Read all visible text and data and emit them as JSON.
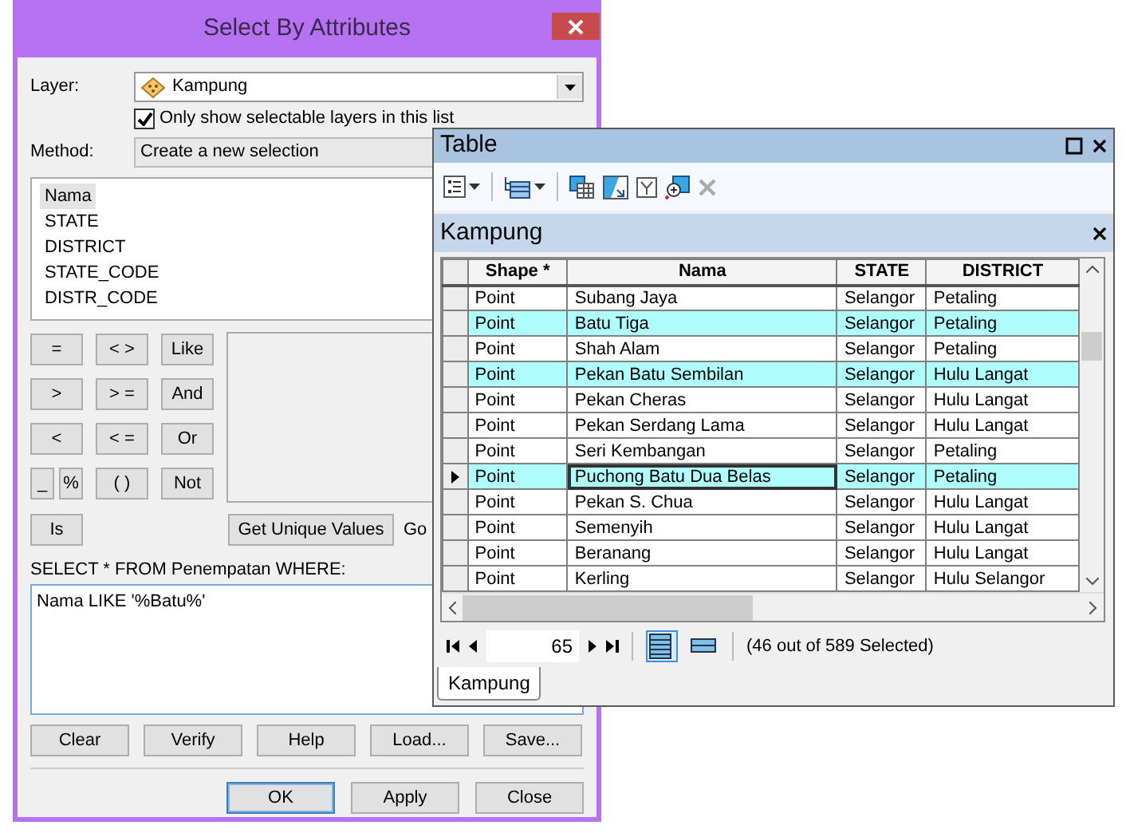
{
  "dialog": {
    "title": "Select By Attributes",
    "layer": {
      "label": "Layer:",
      "value": "Kampung"
    },
    "only_selectable": {
      "label": "Only show selectable layers in this list",
      "checked": true
    },
    "method": {
      "label": "Method:",
      "value": "Create a new selection"
    },
    "fields": [
      {
        "label": "Nama",
        "selected": true
      },
      {
        "label": "STATE",
        "selected": false
      },
      {
        "label": "DISTRICT",
        "selected": false
      },
      {
        "label": "STATE_CODE",
        "selected": false
      },
      {
        "label": "DISTR_CODE",
        "selected": false
      }
    ],
    "operator_rows": [
      [
        [
          "="
        ],
        [
          "< >"
        ],
        [
          "Like"
        ]
      ],
      [
        [
          ">"
        ],
        [
          "> ="
        ],
        [
          "And"
        ]
      ],
      [
        [
          "<"
        ],
        [
          "< ="
        ],
        [
          "Or"
        ]
      ],
      [
        [
          "_",
          "%"
        ],
        [
          "( )"
        ],
        [
          "Not"
        ]
      ]
    ],
    "is_button": "Is",
    "unique_values_button": "Get Unique Values",
    "go_to_button": "Go",
    "query_label": "SELECT * FROM Penempatan WHERE:",
    "query": "Nama LIKE '%Batu%'",
    "buttons": [
      "Clear",
      "Verify",
      "Help",
      "Load...",
      "Save..."
    ],
    "footer_buttons": [
      {
        "label": "OK",
        "default": true
      },
      {
        "label": "Apply",
        "default": false
      },
      {
        "label": "Close",
        "default": false
      }
    ]
  },
  "table_window": {
    "title": "Table",
    "layer_title": "Kampung",
    "columns": [
      "Shape *",
      "Nama",
      "STATE",
      "DISTRICT"
    ],
    "rows": [
      {
        "cells": [
          "Point",
          "Subang Jaya",
          "Selangor",
          "Petaling"
        ],
        "selected": false,
        "current": false
      },
      {
        "cells": [
          "Point",
          "Batu Tiga",
          "Selangor",
          "Petaling"
        ],
        "selected": true,
        "current": false
      },
      {
        "cells": [
          "Point",
          "Shah Alam",
          "Selangor",
          "Petaling"
        ],
        "selected": false,
        "current": false
      },
      {
        "cells": [
          "Point",
          "Pekan Batu Sembilan",
          "Selangor",
          "Hulu Langat"
        ],
        "selected": true,
        "current": false
      },
      {
        "cells": [
          "Point",
          "Pekan Cheras",
          "Selangor",
          "Hulu Langat"
        ],
        "selected": false,
        "current": false
      },
      {
        "cells": [
          "Point",
          "Pekan Serdang Lama",
          "Selangor",
          "Hulu Langat"
        ],
        "selected": false,
        "current": false
      },
      {
        "cells": [
          "Point",
          "Seri Kembangan",
          "Selangor",
          "Petaling"
        ],
        "selected": false,
        "current": false
      },
      {
        "cells": [
          "Point",
          "Puchong Batu Dua Belas",
          "Selangor",
          "Petaling"
        ],
        "selected": true,
        "current": true
      },
      {
        "cells": [
          "Point",
          "Pekan S. Chua",
          "Selangor",
          "Hulu Langat"
        ],
        "selected": false,
        "current": false
      },
      {
        "cells": [
          "Point",
          "Semenyih",
          "Selangor",
          "Hulu Langat"
        ],
        "selected": false,
        "current": false
      },
      {
        "cells": [
          "Point",
          "Beranang",
          "Selangor",
          "Hulu Langat"
        ],
        "selected": false,
        "current": false
      },
      {
        "cells": [
          "Point",
          "Kerling",
          "Selangor",
          "Hulu Selangor"
        ],
        "selected": false,
        "current": false
      }
    ],
    "record": "65",
    "view_modes": [
      {
        "selected": true
      },
      {
        "selected": false
      }
    ],
    "status": "(46 out of 589 Selected)",
    "tabs": [
      {
        "label": "Kampung",
        "selected": true
      }
    ]
  }
}
